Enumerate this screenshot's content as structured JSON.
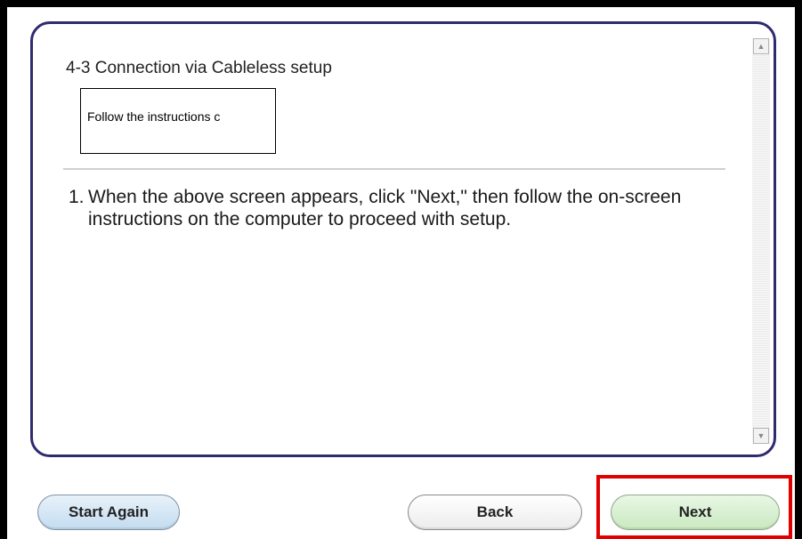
{
  "panel": {
    "section_title": "4-3 Connection via Cableless setup",
    "inner_screen_text": "Follow the instructions c",
    "step_number": "1.",
    "step_text": "When the above screen appears, click \"Next,\" then follow the on-screen instructions on the computer to proceed with setup.",
    "scroll_up_glyph": "▲",
    "scroll_down_glyph": "▼"
  },
  "buttons": {
    "start_again": "Start Again",
    "back": "Back",
    "next": "Next"
  },
  "colors": {
    "panel_border": "#2f2b6f",
    "highlight": "#e00000"
  }
}
